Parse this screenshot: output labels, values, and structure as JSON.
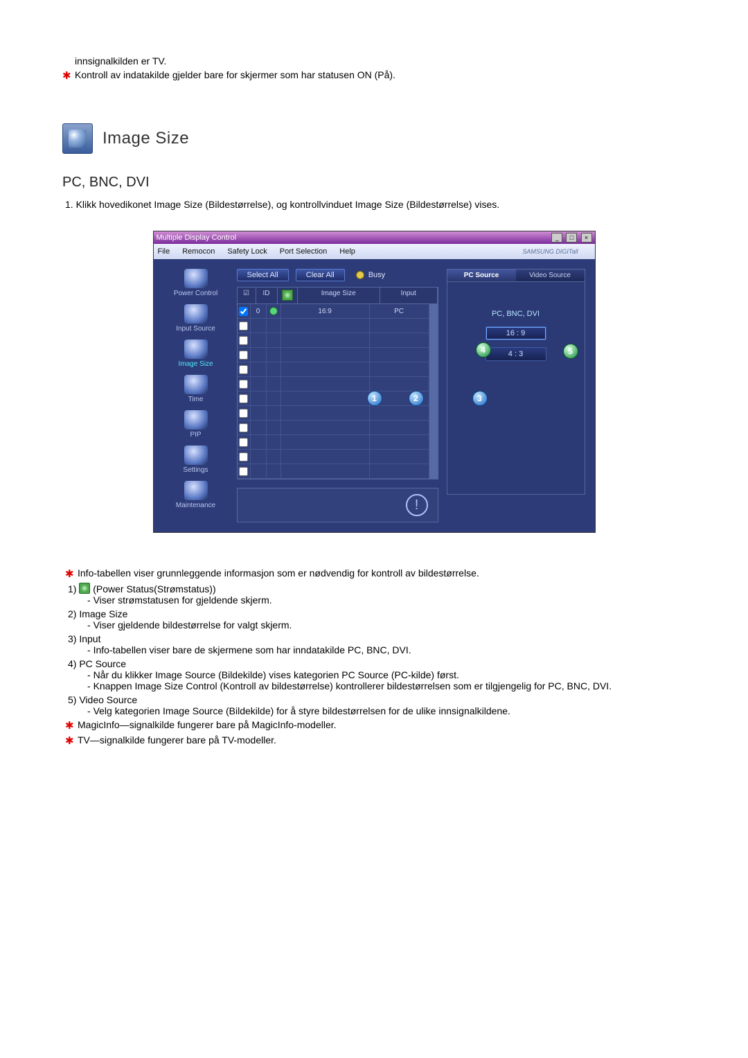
{
  "prelude": {
    "line1": "innsignalkilden er TV.",
    "line2": "Kontroll av indatakilde gjelder bare for skjermer som har statusen ON (På)."
  },
  "section_title": "Image Size",
  "subhead": "PC, BNC, DVI",
  "intro_item": "1.  Klikk hovedikonet Image Size (Bildestørrelse), og kontrollvinduet Image Size (Bildestørrelse) vises.",
  "app": {
    "title": "Multiple Display Control",
    "menu": [
      "File",
      "Remocon",
      "Safety Lock",
      "Port Selection",
      "Help"
    ],
    "brand": "SAMSUNG DIGITall",
    "buttons": {
      "select_all": "Select All",
      "clear_all": "Clear All"
    },
    "busy": "Busy",
    "sidebar": [
      "Power Control",
      "Input Source",
      "Image Size",
      "Time",
      "PIP",
      "Settings",
      "Maintenance"
    ],
    "grid": {
      "headers": {
        "id": "ID",
        "image_size": "Image Size",
        "input": "Input"
      },
      "row": {
        "id": "0",
        "image_size": "16:9",
        "input": "PC"
      }
    },
    "tabs": {
      "pc": "PC Source",
      "video": "Video Source"
    },
    "pclabel": "PC, BNC, DVI",
    "ratios": [
      "16 : 9",
      "4 : 3"
    ]
  },
  "notes": {
    "star1": "Info-tabellen viser grunnleggende informasjon som er nødvendig for kontroll av bildestørrelse.",
    "n1_a": "(Power Status(Strømstatus))",
    "n1_b": "Viser strømstatusen for gjeldende skjerm.",
    "n2_a": "Image Size",
    "n2_b": "Viser gjeldende bildestørrelse for valgt skjerm.",
    "n3_a": "Input",
    "n3_b": "Info-tabellen viser bare de skjermene som har inndatakilde PC, BNC, DVI.",
    "n4_a": "PC Source",
    "n4_b": "Når du klikker Image Source (Bildekilde) vises kategorien PC Source (PC-kilde) først.",
    "n4_c": "Knappen Image Size Control (Kontroll av bildestørrelse) kontrollerer bildestørrelsen som er tilgjengelig for PC, BNC, DVI.",
    "n5_a": "Video Source",
    "n5_b": "Velg kategorien Image Source (Bildekilde) for å styre bildestørrelsen for de ulike innsignalkildene.",
    "star2": "MagicInfo—signalkilde fungerer bare på MagicInfo-modeller.",
    "star3": "TV—signalkilde fungerer bare på TV-modeller."
  },
  "labels": {
    "n1_num": "1) ",
    "n2_num": "2)  ",
    "n3_num": "3)  ",
    "n4_num": "4)  ",
    "n5_num": "5)  "
  }
}
